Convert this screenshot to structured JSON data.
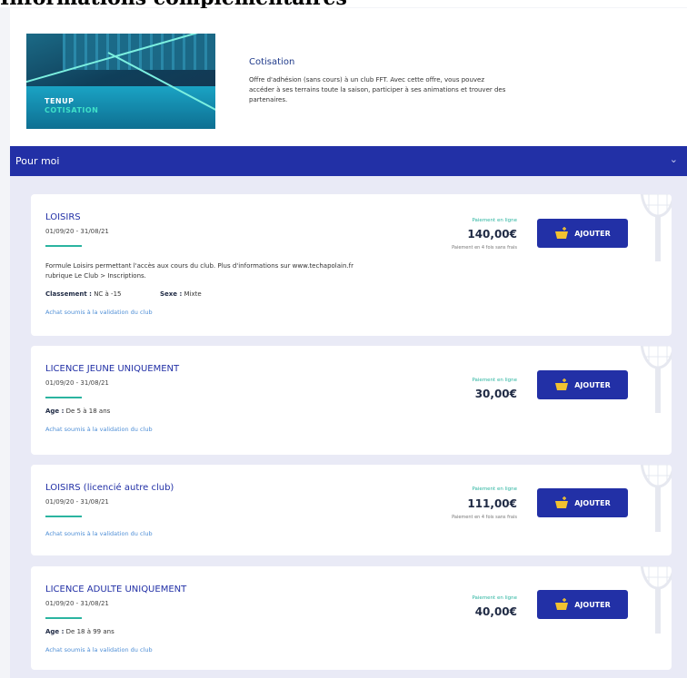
{
  "cut_heading": "Informations complémentaires",
  "offer": {
    "image_brand": "TENUP",
    "image_caption": "COTISATION",
    "title": "Cotisation",
    "description": "Offre d'adhésion (sans cours) à un club FFT. Avec cette offre, vous pouvez accéder à ses terrains toute la saison, participer à ses animations et trouver des partenaires."
  },
  "section": {
    "label": "Pour moi",
    "chevron_icon": "chevron-down-icon"
  },
  "colors": {
    "primary": "#2230a6",
    "accent": "#2bb4a0",
    "link": "#4f8fd6"
  },
  "products": [
    {
      "title": "LOISIRS",
      "dates": "01/09/20 - 31/08/21",
      "description": "Formule Loisirs permettant l'accès aux cours du club. Plus d'informations sur www.techapolain.fr rubrique Le Club > Inscriptions.",
      "classement_label": "Classement :",
      "classement_value": "NC à -15",
      "sexe_label": "Sexe :",
      "sexe_value": "Mixte",
      "note": "Achat soumis à la validation du club",
      "payment_online": "Paiement en ligne",
      "price": "140,00€",
      "payment_split": "Paiement en 4 fois sans frais",
      "button": "AJOUTER"
    },
    {
      "title": "LICENCE JEUNE UNIQUEMENT",
      "dates": "01/09/20 - 31/08/21",
      "age_label": "Age :",
      "age_value": "De 5 à 18 ans",
      "note": "Achat soumis à la validation du club",
      "payment_online": "Paiement en ligne",
      "price": "30,00€",
      "button": "AJOUTER"
    },
    {
      "title": "LOISIRS (licencié autre club)",
      "dates": "01/09/20 - 31/08/21",
      "note": "Achat soumis à la validation du club",
      "payment_online": "Paiement en ligne",
      "price": "111,00€",
      "payment_split": "Paiement en 4 fois sans frais",
      "button": "AJOUTER"
    },
    {
      "title": "LICENCE ADULTE UNIQUEMENT",
      "dates": "01/09/20 - 31/08/21",
      "age_label": "Age :",
      "age_value": "De 18 à 99 ans",
      "note": "Achat soumis à la validation du club",
      "payment_online": "Paiement en ligne",
      "price": "40,00€",
      "button": "AJOUTER"
    }
  ]
}
